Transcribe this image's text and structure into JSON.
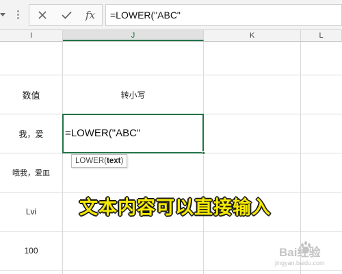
{
  "formula_bar": {
    "fx_label": "fx",
    "formula": "=LOWER(\"ABC\""
  },
  "columns": [
    "I",
    "J",
    "K",
    "L"
  ],
  "active_column": "J",
  "cells": {
    "header_value": "数值",
    "header_lower": "转小写",
    "row1_value": "我，爱",
    "row2_value": "哦我，爱皿",
    "row3_value": "Lvi",
    "row4_value": "100"
  },
  "active_cell": {
    "text": "=LOWER(\"ABC\""
  },
  "tooltip": {
    "func": "LOWER(",
    "arg": "text",
    "close": ")"
  },
  "caption": "文本内容可以直接输入",
  "watermark": {
    "brand": "Bai经验",
    "url": "jingyan.baidu.com"
  },
  "colors": {
    "accent": "#217346",
    "caption": "#f5e900"
  },
  "icons": [
    "chevron-down-icon",
    "more-dots-icon",
    "cancel-icon",
    "enter-check-icon",
    "insert-function-icon",
    "paw-icon"
  ]
}
